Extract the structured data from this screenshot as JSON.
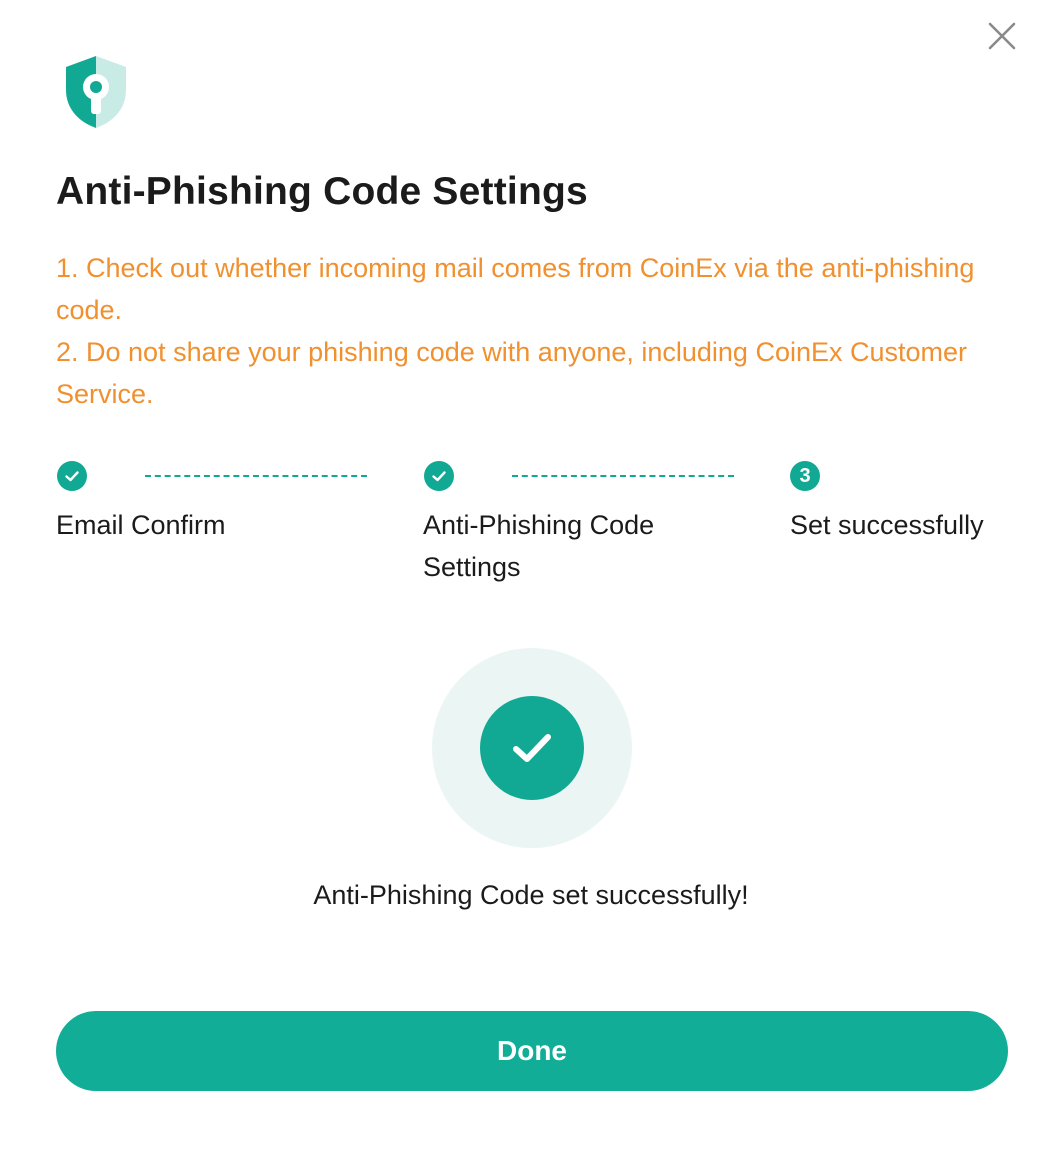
{
  "dialog": {
    "title": "Anti-Phishing Code Settings",
    "notices": [
      "1. Check out whether incoming mail comes from CoinEx via the anti-phishing code.",
      "2. Do not share your phishing code with anyone, including CoinEx Customer Service."
    ],
    "steps": [
      {
        "label": "Email Confirm",
        "status": "done",
        "number": "1"
      },
      {
        "label": "Anti-Phishing Code Settings",
        "status": "done",
        "number": "2"
      },
      {
        "label": "Set successfully",
        "status": "current",
        "number": "3"
      }
    ],
    "success_message": "Anti-Phishing Code set successfully!",
    "done_label": "Done"
  },
  "icons": {
    "close": "close-icon",
    "shield": "shield-lock-icon",
    "step_check": "check-icon",
    "success": "success-check-icon"
  },
  "colors": {
    "accent": "#12a994",
    "notice": "#f0902f",
    "success_ring": "#ebf6f4"
  }
}
